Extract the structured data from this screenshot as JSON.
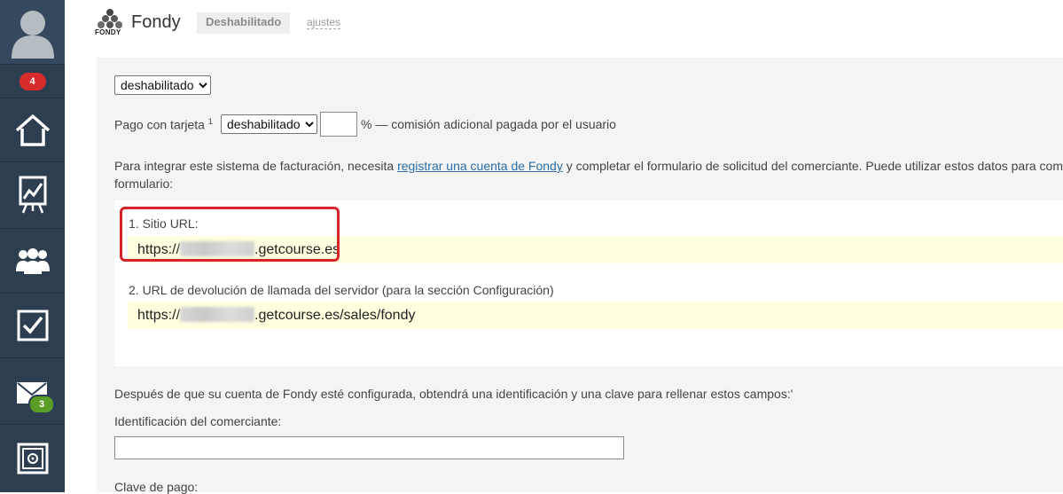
{
  "sidebar": {
    "notification_count": "4",
    "mail_count": "3",
    "items": [
      {
        "icon": "user-avatar-icon"
      },
      {
        "icon": "home-icon"
      },
      {
        "icon": "statistics-board-icon"
      },
      {
        "icon": "users-group-icon"
      },
      {
        "icon": "tasks-checkbox-icon"
      },
      {
        "icon": "mail-icon"
      },
      {
        "icon": "safe-icon"
      }
    ]
  },
  "header": {
    "logo_text": "FONDY",
    "title": "Fondy",
    "status": "Deshabilitado",
    "settings_link": "ajustes"
  },
  "form": {
    "status_select": {
      "selected": "deshabilitado"
    },
    "card_payment": {
      "label": "Pago con tarjeta",
      "footnote": "1",
      "selected": "deshabilitado",
      "commission_value": "",
      "commission_suffix": "% — comisión adicional pagada por el usuario"
    },
    "intro": {
      "part1": "Para integrar este sistema de facturación, necesita ",
      "link": "registrar una cuenta de Fondy",
      "part2": " y completar el formulario de solicitud del comerciante. Puede utilizar estos datos para com",
      "line2": "formulario:"
    },
    "urls": {
      "site_url_label": "1. Sitio URL:",
      "site_url_prefix": "https://",
      "site_url_suffix": ".getcourse.es",
      "callback_label": "2. URL de devolución de llamada del servidor (para la sección Configuración)",
      "callback_prefix": "https://",
      "callback_suffix": ".getcourse.es/sales/fondy"
    },
    "after_setup_text": "Después de que su cuenta de Fondy esté configurada, obtendrá una identificación y una clave para rellenar estos campos:'",
    "merchant_id_label": "Identificación del comerciante:",
    "merchant_id_value": "",
    "payment_key_label": "Clave de pago:"
  },
  "colors": {
    "sidebar_bg": "#2c3e50",
    "highlight_red": "#d9232b",
    "link_blue": "#2a6ea8",
    "url_strip_bg": "#ffffdf"
  }
}
